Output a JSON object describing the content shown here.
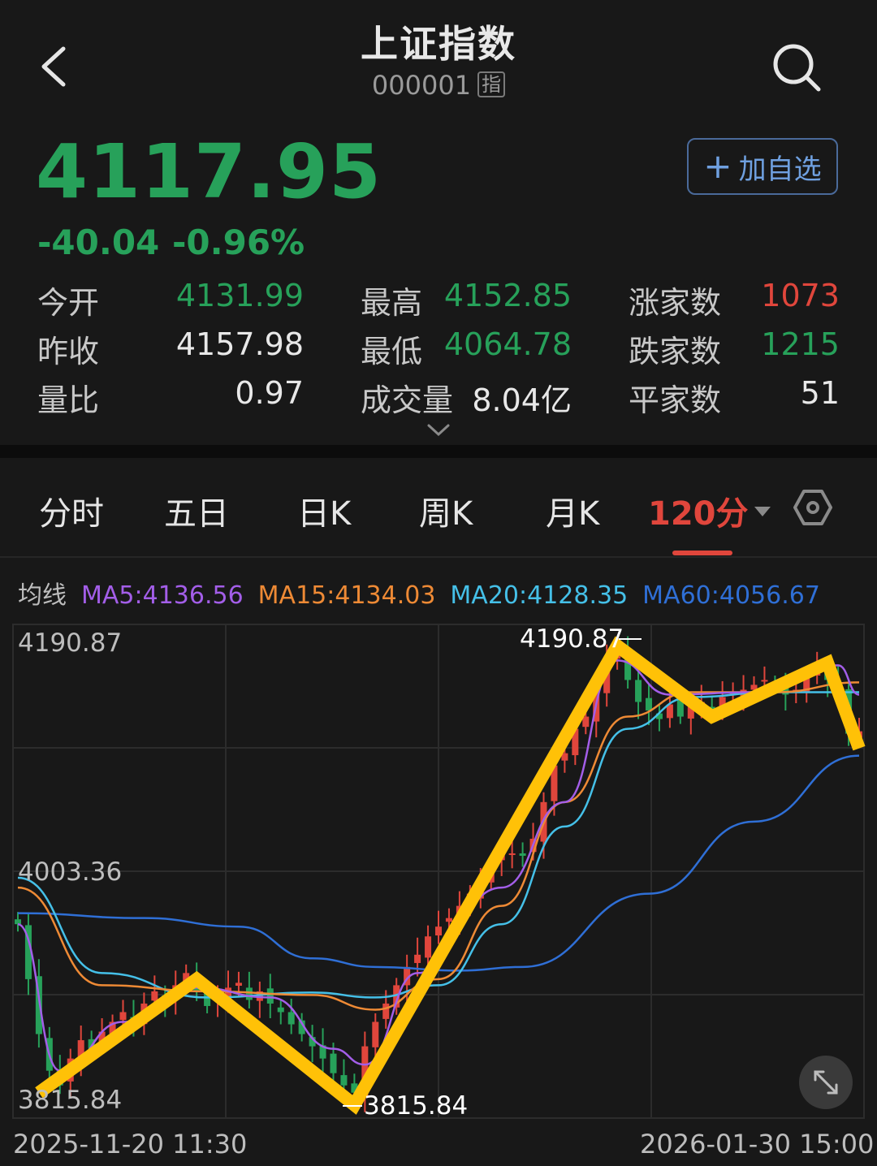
{
  "header": {
    "title": "上证指数",
    "code": "000001",
    "code_tag": "指",
    "back_icon": "chevron-left-icon",
    "search_icon": "search-icon"
  },
  "quote": {
    "price": "4117.95",
    "change": "-40.04",
    "change_pct": "-0.96%",
    "add_label": "加自选",
    "price_color": "#27a15a"
  },
  "stats": {
    "open": {
      "label": "今开",
      "value": "4131.99"
    },
    "prev_close": {
      "label": "昨收",
      "value": "4157.98"
    },
    "volume_ratio": {
      "label": "量比",
      "value": "0.97"
    },
    "high": {
      "label": "最高",
      "value": "4152.85"
    },
    "low": {
      "label": "最低",
      "value": "4064.78"
    },
    "volume": {
      "label": "成交量",
      "value": "8.04亿"
    },
    "up_count": {
      "label": "涨家数",
      "value": "1073"
    },
    "down_count": {
      "label": "跌家数",
      "value": "1215"
    },
    "flat_count": {
      "label": "平家数",
      "value": "51"
    }
  },
  "tabs": [
    {
      "label": "分时"
    },
    {
      "label": "五日"
    },
    {
      "label": "日K"
    },
    {
      "label": "周K"
    },
    {
      "label": "月K"
    },
    {
      "label": "120分",
      "active": true
    }
  ],
  "ma": {
    "label": "均线",
    "ma5": "MA5:4136.56",
    "ma15": "MA15:4134.03",
    "ma20": "MA20:4128.35",
    "ma60": "MA60:4056.67",
    "colors": {
      "ma5": "#a35ee8",
      "ma15": "#ee8a35",
      "ma20": "#45c0e8",
      "ma60": "#2f6fd6"
    }
  },
  "chart_data": {
    "type": "candlestick",
    "y_labels": [
      "4190.87",
      "4003.36",
      "3815.84"
    ],
    "ylim": [
      3815.84,
      4190.87
    ],
    "x_start": "2025-11-20 11:30",
    "x_end": "2026-01-30 15:00",
    "max_marker": "4190.87",
    "min_marker": "3815.84",
    "up_color": "#e0463c",
    "down_color": "#27a15a",
    "overlay_color": "#ffc107",
    "overlay_zigzag": [
      {
        "i": 2,
        "v": 3822
      },
      {
        "i": 17,
        "v": 3915
      },
      {
        "i": 32,
        "v": 3812
      },
      {
        "i": 57,
        "v": 4188
      },
      {
        "i": 66,
        "v": 4130
      },
      {
        "i": 77,
        "v": 4174
      },
      {
        "i": 80,
        "v": 4104
      }
    ],
    "ma60": [
      {
        "i": 0,
        "v": 3969
      },
      {
        "i": 12,
        "v": 3965
      },
      {
        "i": 21,
        "v": 3958
      },
      {
        "i": 28,
        "v": 3932
      },
      {
        "i": 34,
        "v": 3925
      },
      {
        "i": 42,
        "v": 3922
      },
      {
        "i": 48,
        "v": 3925
      },
      {
        "i": 60,
        "v": 3985
      },
      {
        "i": 70,
        "v": 4044
      },
      {
        "i": 80,
        "v": 4098
      }
    ],
    "ma20": [
      {
        "i": 0,
        "v": 3998
      },
      {
        "i": 8,
        "v": 3920
      },
      {
        "i": 18,
        "v": 3900
      },
      {
        "i": 28,
        "v": 3904
      },
      {
        "i": 34,
        "v": 3900
      },
      {
        "i": 40,
        "v": 3910
      },
      {
        "i": 46,
        "v": 3960
      },
      {
        "i": 52,
        "v": 4040
      },
      {
        "i": 58,
        "v": 4120
      },
      {
        "i": 64,
        "v": 4146
      },
      {
        "i": 72,
        "v": 4150
      },
      {
        "i": 80,
        "v": 4150
      }
    ],
    "ma15": [
      {
        "i": 0,
        "v": 3990
      },
      {
        "i": 8,
        "v": 3910
      },
      {
        "i": 18,
        "v": 3905
      },
      {
        "i": 28,
        "v": 3902
      },
      {
        "i": 34,
        "v": 3890
      },
      {
        "i": 40,
        "v": 3915
      },
      {
        "i": 46,
        "v": 3975
      },
      {
        "i": 52,
        "v": 4060
      },
      {
        "i": 58,
        "v": 4130
      },
      {
        "i": 64,
        "v": 4150
      },
      {
        "i": 72,
        "v": 4150
      },
      {
        "i": 80,
        "v": 4158
      }
    ],
    "ma5": [
      {
        "i": 0,
        "v": 3960
      },
      {
        "i": 4,
        "v": 3840
      },
      {
        "i": 10,
        "v": 3880
      },
      {
        "i": 17,
        "v": 3908
      },
      {
        "i": 24,
        "v": 3900
      },
      {
        "i": 30,
        "v": 3858
      },
      {
        "i": 33,
        "v": 3845
      },
      {
        "i": 38,
        "v": 3920
      },
      {
        "i": 46,
        "v": 3990
      },
      {
        "i": 52,
        "v": 4060
      },
      {
        "i": 57,
        "v": 4176
      },
      {
        "i": 62,
        "v": 4148
      },
      {
        "i": 70,
        "v": 4150
      },
      {
        "i": 78,
        "v": 4172
      },
      {
        "i": 80,
        "v": 4148
      }
    ],
    "closes": [
      3960,
      3915,
      3870,
      3840,
      3828,
      3850,
      3865,
      3858,
      3872,
      3880,
      3888,
      3879,
      3895,
      3905,
      3898,
      3910,
      3920,
      3905,
      3893,
      3900,
      3908,
      3912,
      3898,
      3905,
      3895,
      3888,
      3878,
      3870,
      3860,
      3850,
      3838,
      3828,
      3822,
      3860,
      3880,
      3895,
      3910,
      3925,
      3935,
      3950,
      3958,
      3965,
      3975,
      3985,
      3995,
      4010,
      4020,
      4018,
      4016,
      4030,
      4060,
      4090,
      4100,
      4120,
      4130,
      4150,
      4175,
      4186,
      4160,
      4142,
      4135,
      4128,
      4140,
      4130,
      4138,
      4142,
      4135,
      4146,
      4150,
      4152,
      4156,
      4160,
      4155,
      4148,
      4152,
      4162,
      4170,
      4160,
      4150,
      4116,
      4118
    ]
  },
  "icons": {
    "settings": "hexagon-settings-icon",
    "expand": "expand-arrows-icon",
    "dropdown": "triangle-down-icon"
  }
}
